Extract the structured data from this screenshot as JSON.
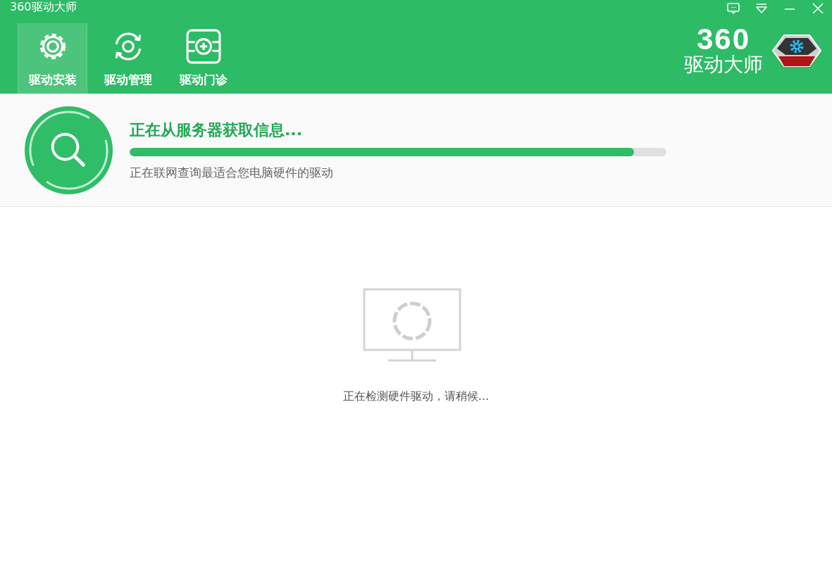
{
  "window": {
    "title": "360驱动大师"
  },
  "tabs": [
    {
      "label": "驱动安装",
      "kind": "gear",
      "selected": true
    },
    {
      "label": "驱动管理",
      "kind": "sync",
      "selected": false
    },
    {
      "label": "驱动门诊",
      "kind": "clinic",
      "selected": false
    }
  ],
  "logo": {
    "number": "360",
    "name": "驱动大师"
  },
  "status": {
    "title": "正在从服务器获取信息...",
    "level": 0.94,
    "detail": "正在联网查询最适合您电脑硬件的驱动"
  },
  "detection": {
    "message": "正在检测硬件驱动，请稍候..."
  }
}
